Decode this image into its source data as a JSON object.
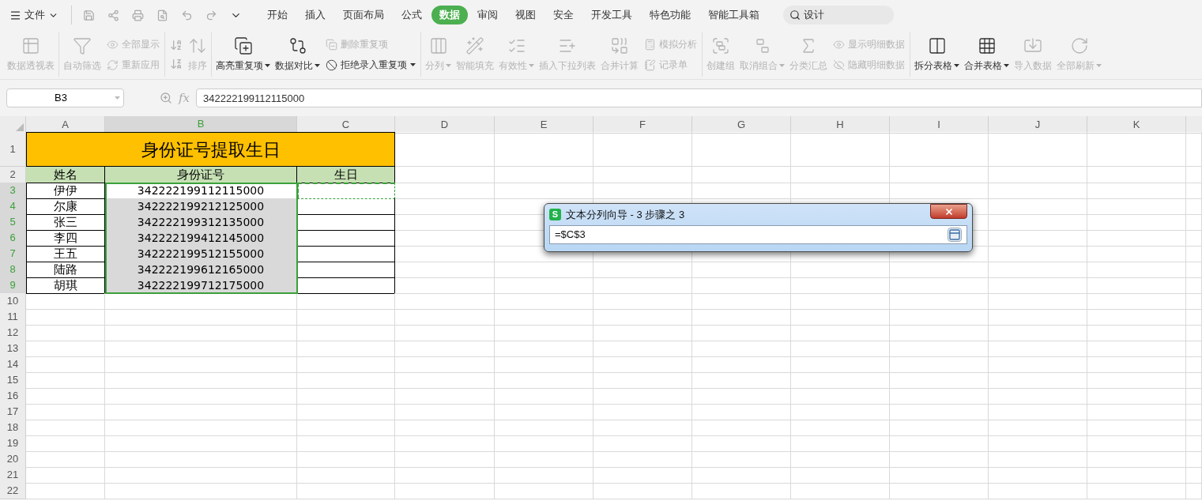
{
  "menu": {
    "file_label": "文件",
    "tabs": [
      {
        "label": "开始",
        "selected": false
      },
      {
        "label": "插入",
        "selected": false
      },
      {
        "label": "页面布局",
        "selected": false
      },
      {
        "label": "公式",
        "selected": false
      },
      {
        "label": "数据",
        "selected": true
      },
      {
        "label": "审阅",
        "selected": false
      },
      {
        "label": "视图",
        "selected": false
      },
      {
        "label": "安全",
        "selected": false
      },
      {
        "label": "开发工具",
        "selected": false
      },
      {
        "label": "特色功能",
        "selected": false
      },
      {
        "label": "智能工具箱",
        "selected": false
      }
    ],
    "search": {
      "placeholder": "设计"
    }
  },
  "ribbon": {
    "groups": [
      {
        "items": [
          {
            "kind": "big",
            "label": "数据透视表",
            "disabled": true,
            "dropdown": false
          }
        ]
      },
      {
        "items": [
          {
            "kind": "big",
            "label": "自动筛选",
            "disabled": true,
            "dropdown": false
          },
          {
            "kind": "stack",
            "items": [
              {
                "label": "全部显示",
                "disabled": true,
                "dropdown": false
              },
              {
                "label": "重新应用",
                "disabled": true,
                "dropdown": false
              }
            ]
          }
        ]
      },
      {
        "items": [
          {
            "kind": "icons",
            "disabled": true
          },
          {
            "kind": "big",
            "label": "排序",
            "disabled": true,
            "dropdown": false
          }
        ]
      },
      {
        "items": [
          {
            "kind": "big",
            "label": "高亮重复项",
            "disabled": false,
            "dropdown": true
          },
          {
            "kind": "big",
            "label": "数据对比",
            "disabled": false,
            "dropdown": true
          },
          {
            "kind": "stack",
            "items": [
              {
                "label": "删除重复项",
                "disabled": true,
                "dropdown": false
              },
              {
                "label": "拒绝录入重复项",
                "disabled": false,
                "dropdown": true
              }
            ]
          }
        ]
      },
      {
        "items": [
          {
            "kind": "big",
            "label": "分列",
            "disabled": true,
            "dropdown": true
          },
          {
            "kind": "big",
            "label": "智能填充",
            "disabled": true,
            "dropdown": false
          },
          {
            "kind": "big",
            "label": "有效性",
            "disabled": true,
            "dropdown": true
          },
          {
            "kind": "big",
            "label": "插入下拉列表",
            "disabled": true,
            "dropdown": false
          },
          {
            "kind": "big",
            "label": "合并计算",
            "disabled": true,
            "dropdown": false
          },
          {
            "kind": "stack",
            "items": [
              {
                "label": "模拟分析",
                "disabled": true,
                "dropdown": false
              },
              {
                "label": "记录单",
                "disabled": true,
                "dropdown": false
              }
            ]
          }
        ]
      },
      {
        "items": [
          {
            "kind": "big",
            "label": "创建组",
            "disabled": true,
            "dropdown": false
          },
          {
            "kind": "big",
            "label": "取消组合",
            "disabled": true,
            "dropdown": true
          },
          {
            "kind": "big",
            "label": "分类汇总",
            "disabled": true,
            "dropdown": false
          },
          {
            "kind": "stack",
            "items": [
              {
                "label": "显示明细数据",
                "disabled": true,
                "dropdown": false
              },
              {
                "label": "隐藏明细数据",
                "disabled": true,
                "dropdown": false
              }
            ]
          }
        ]
      },
      {
        "items": [
          {
            "kind": "big",
            "label": "拆分表格",
            "disabled": false,
            "dropdown": true
          },
          {
            "kind": "big",
            "label": "合并表格",
            "disabled": false,
            "dropdown": true
          },
          {
            "kind": "big",
            "label": "导入数据",
            "disabled": true,
            "dropdown": false
          },
          {
            "kind": "big",
            "label": "全部刷新",
            "disabled": true,
            "dropdown": true
          }
        ]
      }
    ]
  },
  "formula_bar": {
    "name_box": "B3",
    "fx": "fx",
    "value": "342222199112115000"
  },
  "sheet": {
    "columns": [
      {
        "label": "A",
        "selected": false
      },
      {
        "label": "B",
        "selected": true
      },
      {
        "label": "C",
        "selected": false
      },
      {
        "label": "D",
        "selected": false
      },
      {
        "label": "E",
        "selected": false
      },
      {
        "label": "F",
        "selected": false
      },
      {
        "label": "G",
        "selected": false
      },
      {
        "label": "H",
        "selected": false
      },
      {
        "label": "I",
        "selected": false
      },
      {
        "label": "J",
        "selected": false
      },
      {
        "label": "K",
        "selected": false
      }
    ],
    "rows": [
      {
        "label": "1",
        "selected": false
      },
      {
        "label": "2",
        "selected": false
      },
      {
        "label": "3",
        "selected": true
      },
      {
        "label": "4",
        "selected": true
      },
      {
        "label": "5",
        "selected": true
      },
      {
        "label": "6",
        "selected": true
      },
      {
        "label": "7",
        "selected": true
      },
      {
        "label": "8",
        "selected": true
      },
      {
        "label": "9",
        "selected": true
      },
      {
        "label": "10",
        "selected": false
      },
      {
        "label": "11",
        "selected": false
      },
      {
        "label": "12",
        "selected": false
      },
      {
        "label": "13",
        "selected": false
      },
      {
        "label": "14",
        "selected": false
      },
      {
        "label": "15",
        "selected": false
      },
      {
        "label": "16",
        "selected": false
      },
      {
        "label": "17",
        "selected": false
      },
      {
        "label": "18",
        "selected": false
      },
      {
        "label": "19",
        "selected": false
      },
      {
        "label": "20",
        "selected": false
      },
      {
        "label": "21",
        "selected": false
      },
      {
        "label": "22",
        "selected": false
      }
    ],
    "title": "身份证号提取生日",
    "header": {
      "name": "姓名",
      "id": "身份证号",
      "birthday": "生日"
    },
    "records": [
      {
        "name": "伊伊",
        "id": "342222199112115000",
        "active": true,
        "marquee": true
      },
      {
        "name": "尔康",
        "id": "342222199212125000",
        "active": false,
        "marquee": false
      },
      {
        "name": "张三",
        "id": "342222199312135000",
        "active": false,
        "marquee": false
      },
      {
        "name": "李四",
        "id": "342222199412145000",
        "active": false,
        "marquee": false
      },
      {
        "name": "王五",
        "id": "342222199512155000",
        "active": false,
        "marquee": false
      },
      {
        "name": "陆路",
        "id": "342222199612165000",
        "active": false,
        "marquee": false
      },
      {
        "name": "胡琪",
        "id": "342222199712175000",
        "active": false,
        "marquee": false
      }
    ]
  },
  "dialog": {
    "logo": "S",
    "title": "文本分列向导 - 3 步骤之 3",
    "value": "=$C$3"
  }
}
